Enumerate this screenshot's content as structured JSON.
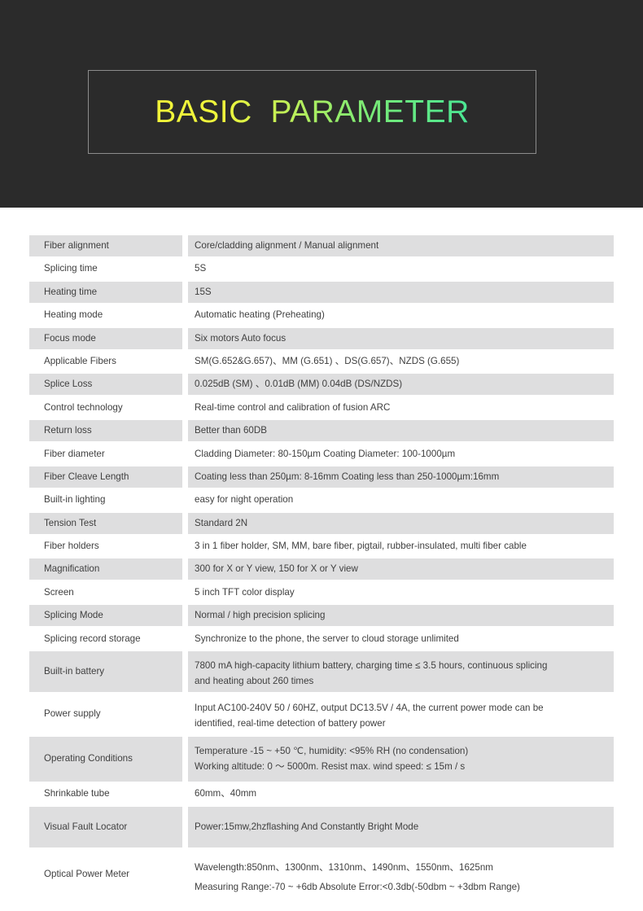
{
  "hero": {
    "title": "BASIC  PARAMETER",
    "gradient_start": "#f2f53a",
    "gradient_end": "#4ae694",
    "background": "#2b2b2b",
    "frame_border": "#8c8c8c"
  },
  "table": {
    "shaded_row_color": "#dededf",
    "plain_row_color": "#ffffff",
    "text_color": "#3f3f3f",
    "rows": [
      {
        "label": "Fiber alignment",
        "values": [
          "Core/cladding alignment  / Manual alignment"
        ]
      },
      {
        "label": "Splicing time",
        "values": [
          "5S"
        ]
      },
      {
        "label": "Heating time",
        "values": [
          "15S"
        ]
      },
      {
        "label": "Heating mode",
        "values": [
          "Automatic heating  (Preheating)"
        ]
      },
      {
        "label": "Focus mode",
        "values": [
          "Six motors  Auto focus"
        ]
      },
      {
        "label": "Applicable Fibers",
        "values": [
          "SM(G.652&G.657)、MM (G.651) 、DS(G.657)、NZDS (G.655)"
        ]
      },
      {
        "label": "Splice Loss",
        "values": [
          "0.025dB (SM) 、0.01dB (MM)  0.04dB (DS/NZDS)"
        ]
      },
      {
        "label": "Control  technology",
        "values": [
          "Real-time control and calibration of fusion ARC"
        ]
      },
      {
        "label": "Return loss",
        "values": [
          "Better than 60DB"
        ]
      },
      {
        "label": "Fiber diameter",
        "values": [
          "Cladding Diameter:  80-150µm   Coating Diameter:  100-1000µm"
        ]
      },
      {
        "label": "Fiber Cleave Length",
        "values": [
          "Coating less than 250µm:  8-16mm  Coating less than 250-1000µm:16mm"
        ]
      },
      {
        "label": "Built-in lighting",
        "values": [
          "easy for night operation"
        ]
      },
      {
        "label": "Tension Test",
        "values": [
          "Standard 2N"
        ]
      },
      {
        "label": "Fiber holders",
        "values": [
          "3 in 1 fiber holder, SM, MM, bare fiber, pigtail, rubber-insulated, multi fiber cable"
        ]
      },
      {
        "label": "Magnification",
        "values": [
          "300 for X or Y view, 150 for X or Y view"
        ]
      },
      {
        "label": "Screen",
        "values": [
          "5 inch TFT color display"
        ]
      },
      {
        "label": "Splicing Mode",
        "values": [
          "Normal / high precision splicing"
        ]
      },
      {
        "label": "Splicing record storage",
        "values": [
          "Synchronize to the phone, the server to cloud storage unlimited"
        ]
      },
      {
        "label": "Built-in battery",
        "values": [
          "7800 mA high-capacity lithium battery, charging time ≤ 3.5 hours, continuous splicing",
          "and heating about 260 times"
        ]
      },
      {
        "label": "Power supply",
        "values": [
          "Input AC100-240V 50 / 60HZ, output DC13.5V / 4A, the current power mode can be",
          "identified, real-time detection of battery power"
        ]
      },
      {
        "label": "Operating Conditions",
        "values": [
          "Temperature -15 ~ +50 ℃, humidity: <95% RH (no condensation)",
          "Working altitude: 0 ～ 5000m. Resist max. wind speed: ≤ 15m / s"
        ]
      },
      {
        "label": "Shrinkable tube",
        "values": [
          "60mm、40mm"
        ]
      },
      {
        "label": "Visual Fault Locator",
        "values": [
          "Power:15mw,2hzflashing And Constantly Bright Mode"
        ]
      },
      {
        "label": "Optical Power Meter",
        "values": [
          "Wavelength:850nm、1300nm、1310nm、1490nm、1550nm、1625nm",
          "Measuring Range:-70 ~ +6db Absolute Error:<0.3db(-50dbm ~ +3dbm Range)"
        ]
      }
    ]
  }
}
